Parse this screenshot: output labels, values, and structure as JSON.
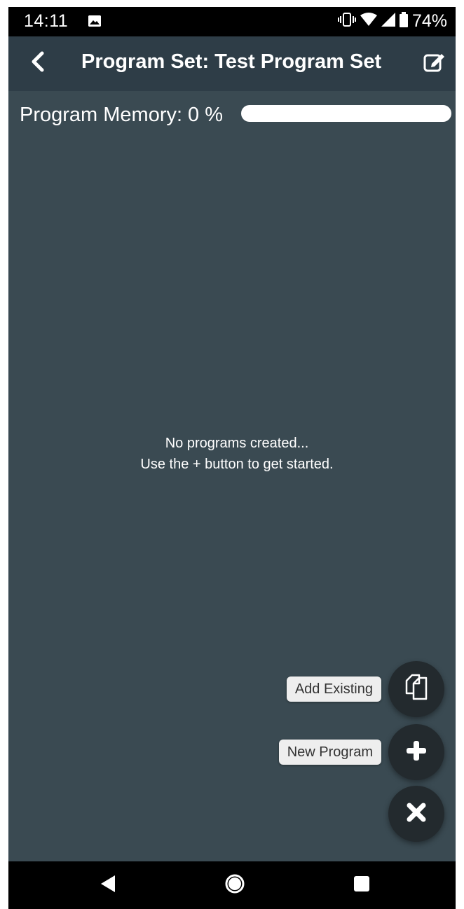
{
  "status_bar": {
    "time": "14:11",
    "battery_percent": "74%",
    "icons": [
      "gallery-icon",
      "vibrate-icon",
      "wifi-icon",
      "signal-icon",
      "battery-icon"
    ]
  },
  "app_bar": {
    "title": "Program Set: Test Program Set",
    "back_icon": "chevron-left-icon",
    "edit_icon": "edit-icon"
  },
  "memory": {
    "label": "Program Memory:",
    "percent_text": "0 %",
    "fill_fraction": 0.0
  },
  "empty_state": {
    "line1": "No programs created...",
    "line2": "Use the + button to get started."
  },
  "fab_menu": {
    "add_existing_label": "Add Existing",
    "add_existing_icon": "copy-icon",
    "new_program_label": "New Program",
    "new_program_icon": "plus-icon",
    "close_icon": "close-icon"
  },
  "nav_bar": {
    "icons": [
      "nav-back-icon",
      "nav-home-icon",
      "nav-recents-icon"
    ]
  },
  "colors": {
    "app_bar": "#2e3d47",
    "content_bg": "#3a4a52",
    "fab_bg": "#232a2e",
    "chip_bg": "#eeeeee"
  }
}
